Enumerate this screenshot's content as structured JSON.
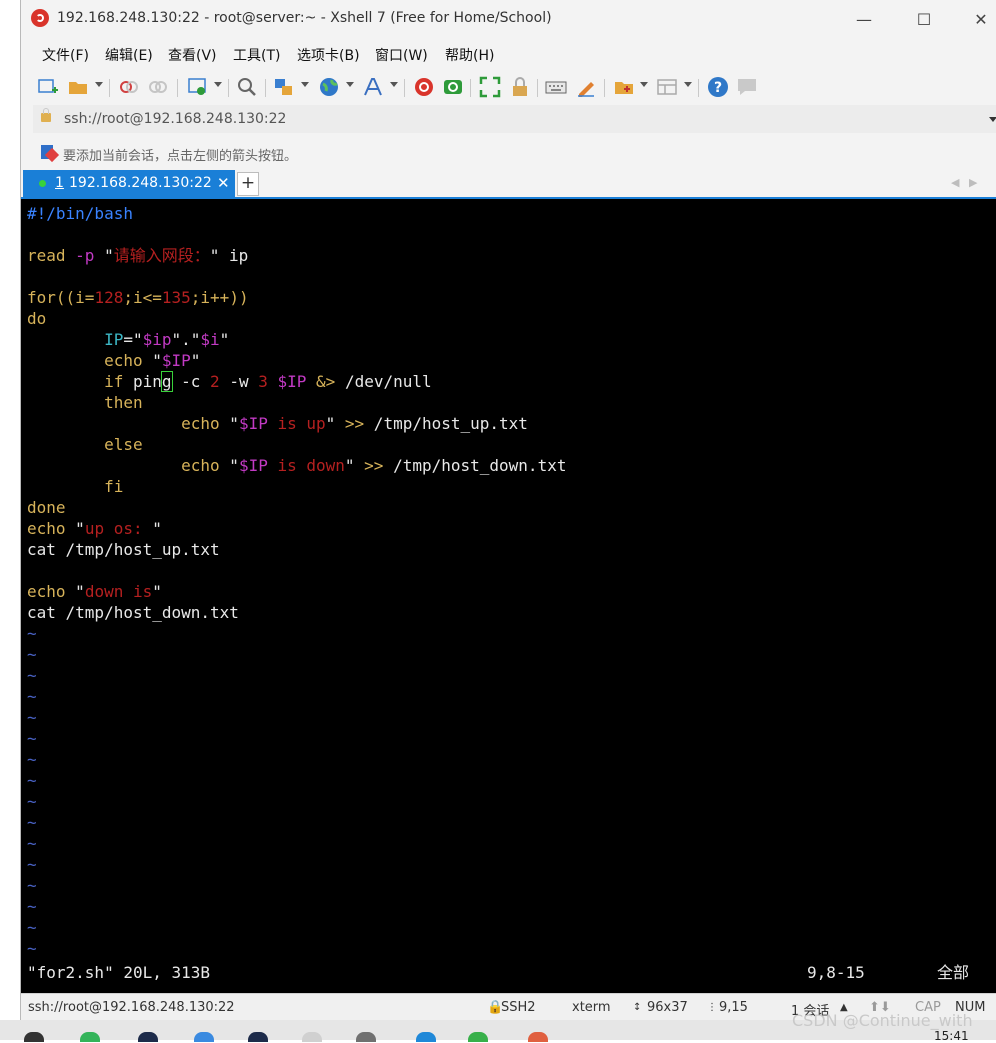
{
  "window": {
    "title": "192.168.248.130:22 - root@server:~ - Xshell 7 (Free for Home/School)",
    "controls": {
      "minimize": "—",
      "maximize": "☐",
      "close": "✕"
    }
  },
  "menu": [
    "文件(F)",
    "编辑(E)",
    "查看(V)",
    "工具(T)",
    "选项卡(B)",
    "窗口(W)",
    "帮助(H)"
  ],
  "address": {
    "value": "ssh://root@192.168.248.130:22"
  },
  "hint": {
    "text": "要添加当前会话，点击左侧的箭头按钮。"
  },
  "tabs": [
    {
      "number": "1",
      "label": " 192.168.248.130:22",
      "close": "✕"
    }
  ],
  "tab_add_label": "+",
  "tab_nav": {
    "left": "◀",
    "right": "▶"
  },
  "editor": {
    "lines": [
      [
        [
          "#!/bin/bash",
          "shebang"
        ]
      ],
      [],
      [
        [
          "read ",
          "kw"
        ],
        [
          "-p ",
          "opt"
        ],
        [
          "\"",
          "plain"
        ],
        [
          "请输入网段：",
          "str"
        ],
        [
          "\" ip",
          "plain"
        ]
      ],
      [],
      [
        [
          "for((i=",
          "kw"
        ],
        [
          "128",
          "num"
        ],
        [
          ";i<=",
          "kw"
        ],
        [
          "135",
          "num"
        ],
        [
          ";i++))",
          "kw"
        ]
      ],
      [
        [
          "do",
          "kw"
        ]
      ],
      [
        [
          "        ",
          "plain"
        ],
        [
          "IP",
          "cyan"
        ],
        [
          "=\"",
          "plain"
        ],
        [
          "$ip",
          "var"
        ],
        [
          "\".\"",
          "plain"
        ],
        [
          "$i",
          "var"
        ],
        [
          "\"",
          "plain"
        ]
      ],
      [
        [
          "        echo ",
          "kw"
        ],
        [
          "\"",
          "plain"
        ],
        [
          "$IP",
          "var"
        ],
        [
          "\"",
          "plain"
        ]
      ],
      [
        [
          "        if ",
          "kw"
        ],
        [
          "pin",
          "plain"
        ],
        [
          "g",
          "cursor"
        ],
        [
          " -c ",
          "plain"
        ],
        [
          "2",
          "num"
        ],
        [
          " -w ",
          "plain"
        ],
        [
          "3",
          "num"
        ],
        [
          " ",
          "plain"
        ],
        [
          "$IP",
          "var"
        ],
        [
          " &> ",
          "kw"
        ],
        [
          "/dev/null",
          "plain"
        ]
      ],
      [
        [
          "        then",
          "kw"
        ]
      ],
      [
        [
          "                echo ",
          "kw"
        ],
        [
          "\"",
          "plain"
        ],
        [
          "$IP",
          "var"
        ],
        [
          " is up",
          "str"
        ],
        [
          "\" ",
          "plain"
        ],
        [
          ">>",
          "kw"
        ],
        [
          " /tmp/host_up.txt",
          "plain"
        ]
      ],
      [
        [
          "        else",
          "kw"
        ]
      ],
      [
        [
          "                echo ",
          "kw"
        ],
        [
          "\"",
          "plain"
        ],
        [
          "$IP",
          "var"
        ],
        [
          " is down",
          "str"
        ],
        [
          "\" ",
          "plain"
        ],
        [
          ">>",
          "kw"
        ],
        [
          " /tmp/host_down.txt",
          "plain"
        ]
      ],
      [
        [
          "        fi",
          "kw"
        ]
      ],
      [
        [
          "done",
          "kw"
        ]
      ],
      [
        [
          "echo ",
          "kw"
        ],
        [
          "\"",
          "plain"
        ],
        [
          "up os: ",
          "str"
        ],
        [
          "\"",
          "plain"
        ]
      ],
      [
        [
          "cat /tmp/host_up.txt",
          "plain"
        ]
      ],
      [],
      [
        [
          "echo ",
          "kw"
        ],
        [
          "\"",
          "plain"
        ],
        [
          "down is",
          "str"
        ],
        [
          "\"",
          "plain"
        ]
      ],
      [
        [
          "cat /tmp/host_down.txt",
          "plain"
        ]
      ]
    ],
    "tilde_count": 16,
    "status_left": "\"for2.sh\" 20L, 313B",
    "status_pos": "9,8-15",
    "status_right": "全部"
  },
  "statusbar": {
    "address": "ssh://root@192.168.248.130:22",
    "protocol": "SSH2",
    "terminal": "xterm",
    "size": "96x37",
    "cursor": "9,15",
    "sessions": "1 会话",
    "caps": "CAP",
    "num": "NUM"
  },
  "watermark": "CSDN @Continue_with",
  "clock": "15:41",
  "colors": {
    "accent": "#1a7fd7",
    "terminal_bg": "#000000",
    "keyword": "#d7b35a",
    "string": "#b52020",
    "variable": "#c23ac4",
    "shebang": "#3a83ff",
    "tilde": "#4a63c7"
  }
}
